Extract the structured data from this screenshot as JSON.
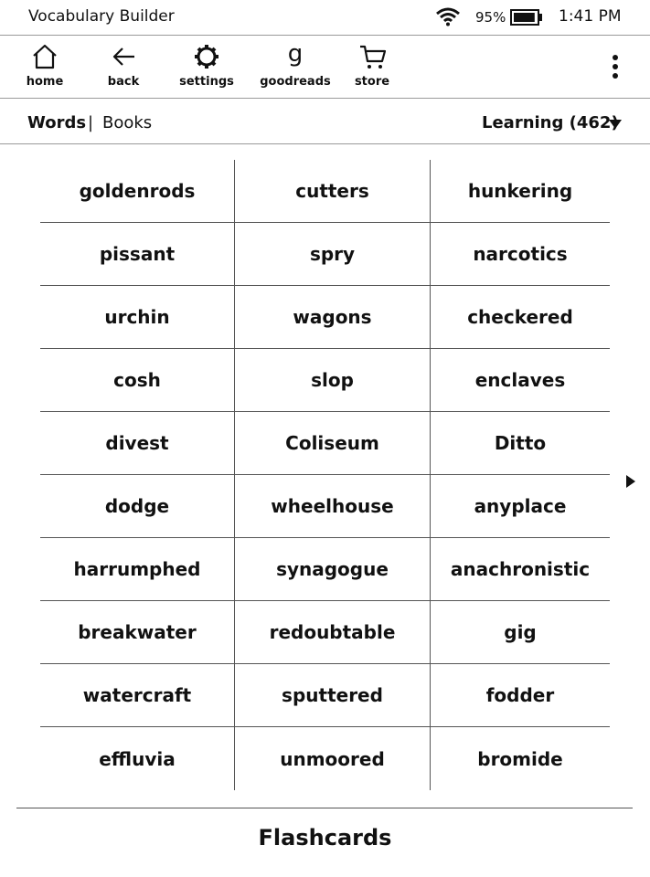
{
  "status": {
    "app_title": "Vocabulary Builder",
    "battery_percent": "95%",
    "battery_level": 0.95,
    "time": "1:41 PM"
  },
  "toolbar": {
    "items": [
      {
        "label": "home",
        "icon": "home-icon"
      },
      {
        "label": "back",
        "icon": "back-arrow-icon"
      },
      {
        "label": "settings",
        "icon": "gear-icon"
      },
      {
        "label": "goodreads",
        "icon": "goodreads-icon"
      },
      {
        "label": "store",
        "icon": "cart-icon"
      }
    ],
    "menu_icon": "more-vertical-icon"
  },
  "subnav": {
    "tab_words": "Words",
    "separator": "|",
    "tab_books": "Books",
    "filter_label": "Learning (462)"
  },
  "words": [
    [
      "goldenrods",
      "cutters",
      "hunkering"
    ],
    [
      "pissant",
      "spry",
      "narcotics"
    ],
    [
      "urchin",
      "wagons",
      "checkered"
    ],
    [
      "cosh",
      "slop",
      "enclaves"
    ],
    [
      "divest",
      "Coliseum",
      "Ditto"
    ],
    [
      "dodge",
      "wheelhouse",
      "anyplace"
    ],
    [
      "harrumphed",
      "synagogue",
      "anachronistic"
    ],
    [
      "breakwater",
      "redoubtable",
      "gig"
    ],
    [
      "watercraft",
      "sputtered",
      "fodder"
    ],
    [
      "effluvia",
      "unmoored",
      "bromide"
    ]
  ],
  "footer": {
    "flashcards_label": "Flashcards"
  }
}
